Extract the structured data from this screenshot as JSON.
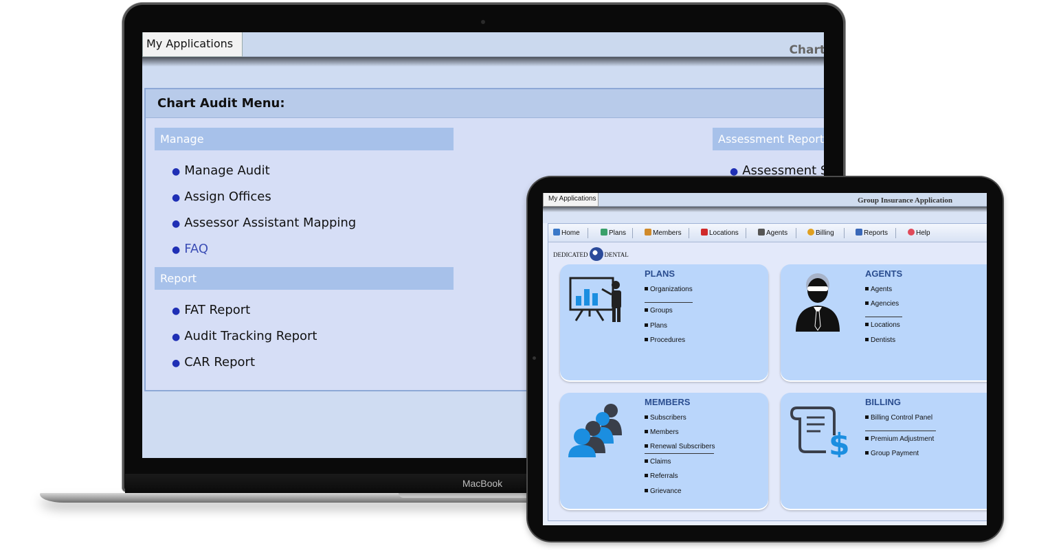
{
  "laptop": {
    "brand": "MacBook",
    "tab_label": "My Applications",
    "app_title": "Chart",
    "menu_title": "Chart Audit Menu:",
    "manage": {
      "header": "Manage",
      "links": [
        "Manage Audit",
        "Assign Offices",
        "Assessor Assistant Mapping",
        "FAQ"
      ]
    },
    "report": {
      "header": "Report",
      "links": [
        "FAT Report",
        "Audit Tracking Report",
        "CAR Report"
      ]
    },
    "assessment": {
      "header": "Assessment Report",
      "links": [
        "Assessment Se"
      ]
    }
  },
  "tablet": {
    "tab_label": "My Applications",
    "app_title": "Group Insurance Application",
    "nav": [
      {
        "label": "Home",
        "icon": "home-icon",
        "color": "#3a78c8"
      },
      {
        "label": "Plans",
        "icon": "plans-icon",
        "color": "#3aa06a"
      },
      {
        "label": "Members",
        "icon": "members-icon",
        "color": "#d08a2a"
      },
      {
        "label": "Locations",
        "icon": "locations-icon",
        "color": "#d02a2a"
      },
      {
        "label": "Agents",
        "icon": "agents-icon",
        "color": "#555555"
      },
      {
        "label": "Billing",
        "icon": "billing-icon",
        "color": "#e0a020"
      },
      {
        "label": "Reports",
        "icon": "reports-icon",
        "color": "#3a68b8"
      },
      {
        "label": "Help",
        "icon": "help-icon",
        "color": "#e04a5a"
      }
    ],
    "logo": {
      "left": "DEDICATED",
      "right": "DENTAL"
    },
    "cards": {
      "plans": {
        "title": "PLANS",
        "items": [
          "Organizations",
          "Groups",
          "Plans",
          "Procedures"
        ]
      },
      "agents": {
        "title": "AGENTS",
        "items": [
          "Agents",
          "Agencies",
          "Locations",
          "Dentists"
        ]
      },
      "members": {
        "title": "MEMBERS",
        "items": [
          "Subscribers",
          "Members",
          "Renewal Subscribers",
          "Claims",
          "Referrals",
          "Grievance"
        ]
      },
      "billing": {
        "title": "BILLING",
        "items": [
          "Billing Control Panel",
          "Premium Adjustment",
          "Group Payment"
        ]
      }
    }
  }
}
